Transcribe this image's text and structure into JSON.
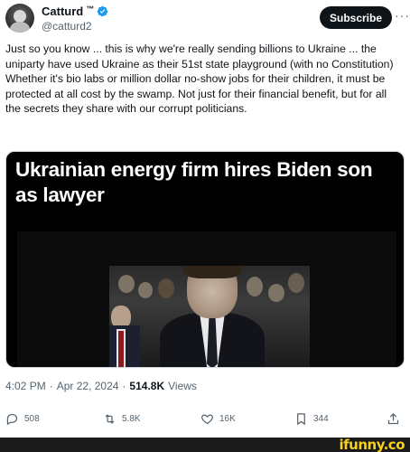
{
  "author": {
    "display_name": "Catturd",
    "tm": "™",
    "handle": "@catturd2",
    "verified_icon": "verified-badge-icon",
    "verified_color": "#1d9bf0"
  },
  "header": {
    "subscribe_label": "Subscribe",
    "more_label": "···"
  },
  "tweet": {
    "text": "Just so you know ... this is why we're really sending billions to Ukraine ... the uniparty have used Ukraine as their 51st state playground (with no Constitution) Whether it's bio labs or million dollar no-show jobs for their children, it must be protected at all cost by the swamp. Not just for their financial benefit, but for all the secrets they share with our corrupt politicians."
  },
  "media": {
    "headline": "Ukrainian energy firm hires Biden son as lawyer"
  },
  "meta": {
    "time": "4:02 PM",
    "separator1": "·",
    "date": "Apr 22, 2024",
    "separator2": "·",
    "views_count": "514.8K",
    "views_label": "Views"
  },
  "actions": {
    "replies": "508",
    "reposts": "5.8K",
    "likes": "16K",
    "bookmarks": "344"
  },
  "watermark": {
    "text": "ifunny.co",
    "color": "#f7d21c"
  },
  "colors": {
    "text_primary": "#0f1419",
    "text_secondary": "#536471",
    "button_dark": "#0f1419"
  }
}
